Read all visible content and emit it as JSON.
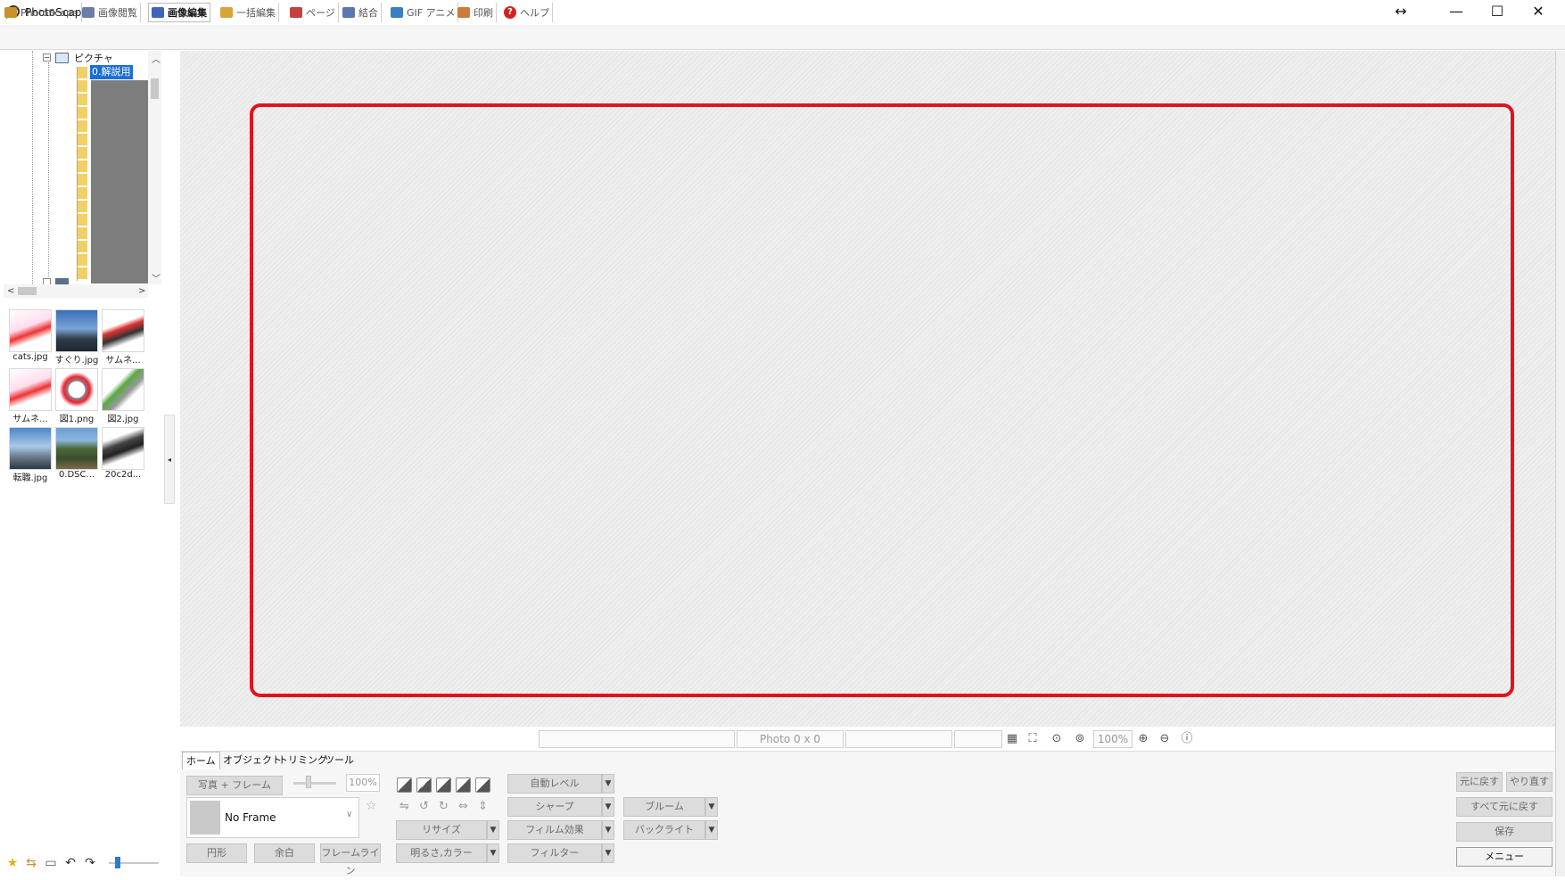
{
  "window": {
    "title": "PhotoScape",
    "controls": {
      "resize": "↔",
      "minimize": "—",
      "maximize": "☐",
      "close": "✕"
    }
  },
  "tabs": [
    {
      "label": "PhotoScape",
      "icon": "photoscape-icon",
      "color": "#c8922a"
    },
    {
      "label": "画像閲覧",
      "icon": "viewer-icon",
      "color": "#6a7fa8"
    },
    {
      "label": "画像編集",
      "icon": "editor-icon",
      "color": "#3f64b8",
      "active": true
    },
    {
      "label": "一括編集",
      "icon": "batch-icon",
      "color": "#d9a23a"
    },
    {
      "label": "ページ",
      "icon": "page-icon",
      "color": "#c74040"
    },
    {
      "label": "結合",
      "icon": "combine-icon",
      "color": "#5a78b0"
    },
    {
      "label": "GIF アニメ",
      "icon": "gif-icon",
      "color": "#3a7fc4"
    },
    {
      "label": "印刷",
      "icon": "print-icon",
      "color": "#d07a3a"
    },
    {
      "label": "ヘルプ",
      "icon": "help-icon",
      "color": "#d62020"
    }
  ],
  "tree": {
    "root": "ピクチャ",
    "selected": "0.解説用",
    "scroll_arrows": {
      "up": "︿",
      "down": "﹀",
      "left": "<",
      "right": ">"
    }
  },
  "thumbnails": [
    {
      "label": "cats.jpg"
    },
    {
      "label": "すぐり.jpg"
    },
    {
      "label": "サムネ..."
    },
    {
      "label": "サムネ..."
    },
    {
      "label": "図1.png"
    },
    {
      "label": "図2.jpg"
    },
    {
      "label": "転職.jpg"
    },
    {
      "label": "0.DSC..."
    },
    {
      "label": "20c2d..."
    }
  ],
  "status": {
    "photo_size": "Photo 0 x 0",
    "zoom": "100%"
  },
  "editor": {
    "subtabs": [
      "ホーム",
      "オブジェクト",
      "トリミング",
      "ツール"
    ],
    "photo_frame_button": "写真 + フレーム",
    "frame_opacity": "100%",
    "frame_name": "No Frame",
    "round_button": "円形",
    "margin_button": "余白",
    "frameline_button": "フレームライン",
    "resize_button": "リサイズ",
    "brightness_button": "明るさ,カラー",
    "auto_level_button": "自動レベル",
    "sharpen_button": "シャープ",
    "film_button": "フィルム効果",
    "filter_button": "フィルター",
    "bloom_button": "ブルーム",
    "backlight_button": "バックライト",
    "undo_button": "元に戻す",
    "redo_button": "やり直す",
    "undo_all_button": "すべて元に戻す",
    "save_button": "保存",
    "menu_button": "メニュー"
  },
  "colors": {
    "highlight_frame": "#e0141e",
    "tree_selection": "#1a6fd6"
  }
}
